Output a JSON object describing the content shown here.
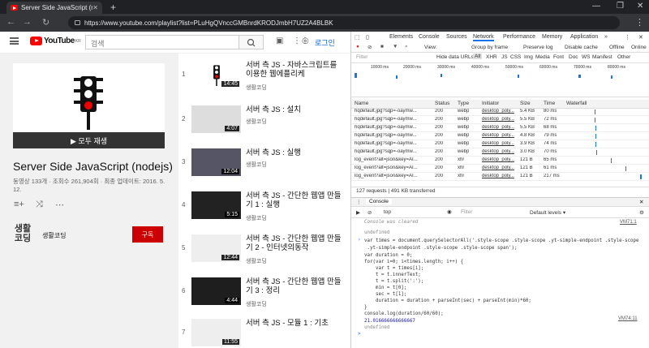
{
  "browser": {
    "tab_title": "Server Side JavaScript (nodejs)",
    "url": "https://www.youtube.com/playlist?list=PLuHgQVnccGMBnrdKRODJmbH7UZ2A4BLBK"
  },
  "yt": {
    "logo": "YouTube",
    "logo_sup": "KR",
    "search_placeholder": "검색",
    "login": "로그인"
  },
  "playlist": {
    "play_all": "▶ 모두 재생",
    "title": "Server Side JavaScript (nodejs)",
    "meta": "동영상 133개 · 조회수 261,904회 · 최종 업데이트: 2016. 5. 12.",
    "channel": "생활코딩",
    "channel_logo": "생활\n코딩",
    "subscribe": "구독"
  },
  "videos": [
    {
      "num": "1",
      "title": "서버 측 JS - 자바스크립트를 이용한 웹에플리케",
      "channel": "생활코딩",
      "duration": "14:45"
    },
    {
      "num": "2",
      "title": "서버 측 JS : 설치",
      "channel": "생활코딩",
      "duration": "4:07"
    },
    {
      "num": "3",
      "title": "서버 측 JS : 실행",
      "channel": "생활코딩",
      "duration": "12:04"
    },
    {
      "num": "4",
      "title": "서버 측 JS - 간단한 웹앱 만들기 1 : 실행",
      "channel": "생활코딩",
      "duration": "5:15"
    },
    {
      "num": "5",
      "title": "서버 측 JS - 간단한 웹앱 만들기 2 - 인터넷의동작",
      "channel": "생활코딩",
      "duration": "12:44"
    },
    {
      "num": "6",
      "title": "서버 측 JS - 간단한 웹앱 만들기 3 : 정리",
      "channel": "생활코딩",
      "duration": "4:44"
    },
    {
      "num": "7",
      "title": "서버 측 JS - 모듈 1 : 기초",
      "channel": "생활코딩",
      "duration": "11:55"
    }
  ],
  "devtools": {
    "tabs": [
      "Elements",
      "Console",
      "Sources",
      "Network",
      "Performance",
      "Memory",
      "Application"
    ],
    "net_toolbar": [
      "View:",
      "Group by frame",
      "Preserve log",
      "Disable cache",
      "Offline",
      "Online"
    ],
    "filter_types": [
      "Filter",
      "Hide data URLs",
      "All",
      "XHR",
      "JS",
      "CSS",
      "Img",
      "Media",
      "Font",
      "Doc",
      "WS",
      "Manifest",
      "Other"
    ],
    "timeline_ticks": [
      "10000 ms",
      "20000 ms",
      "30000 ms",
      "40000 ms",
      "50000 ms",
      "60000 ms",
      "70000 ms",
      "80000 ms"
    ],
    "columns": [
      "Name",
      "Status",
      "Type",
      "Initiator",
      "Size",
      "Time",
      "Waterfall"
    ],
    "rows": [
      {
        "name": "hqdefault.jpg?sqp=-oaymw...",
        "status": "200",
        "type": "webp",
        "init": "desktop_poly...",
        "size": "5.4 KB",
        "time": "80 ms"
      },
      {
        "name": "hqdefault.jpg?sqp=-oaymw...",
        "status": "200",
        "type": "webp",
        "init": "desktop_poly...",
        "size": "5.5 KB",
        "time": "72 ms"
      },
      {
        "name": "hqdefault.jpg?sqp=-oaymw...",
        "status": "200",
        "type": "webp",
        "init": "desktop_poly...",
        "size": "5.5 KB",
        "time": "68 ms"
      },
      {
        "name": "hqdefault.jpg?sqp=-oaymw...",
        "status": "200",
        "type": "webp",
        "init": "desktop_poly...",
        "size": "4.8 KB",
        "time": "79 ms"
      },
      {
        "name": "hqdefault.jpg?sqp=-oaymw...",
        "status": "200",
        "type": "webp",
        "init": "desktop_poly...",
        "size": "3.9 KB",
        "time": "74 ms"
      },
      {
        "name": "hqdefault.jpg?sqp=-oaymw...",
        "status": "200",
        "type": "webp",
        "init": "desktop_poly...",
        "size": "3.0 KB",
        "time": "70 ms"
      },
      {
        "name": "log_event?alt=json&key=AI...",
        "status": "200",
        "type": "xhr",
        "init": "desktop_poly...",
        "size": "121 B",
        "time": "65 ms"
      },
      {
        "name": "log_event?alt=json&key=AI...",
        "status": "200",
        "type": "xhr",
        "init": "desktop_poly...",
        "size": "121 B",
        "time": "61 ms"
      },
      {
        "name": "log_event?alt=json&key=AI...",
        "status": "200",
        "type": "xhr",
        "init": "desktop_poly...",
        "size": "121 B",
        "time": "217 ms"
      }
    ],
    "status": "127 requests | 491 KB transferred",
    "drawer_tab": "Console",
    "console_context": "top",
    "console_filter": "Filter",
    "console_levels": "Default levels ▾",
    "cleared": "Console was cleared",
    "cleared_src": "VM71:1",
    "undefined": "undefined",
    "code": [
      "var times = document.querySelectorAll('.style-scope .style-scope .yt-simple-endpoint .style-scope",
      " .yt-simple-endpoint .style-scope .style-scope span');",
      "var duration = 0;",
      "for(var i=0; i<times.length; i++) {",
      "    var t = times[i];",
      "    t = t.innerText;",
      "    t = t.split(':');",
      "    min = t[0];",
      "    sec = t[1];",
      "    duration = duration + parseInt(sec) + parseInt(min)*60;",
      "}",
      "console.log(duration/60/60);"
    ],
    "result": "21.016666666666667",
    "result_src": "VM74:11",
    "prompt": ">"
  }
}
